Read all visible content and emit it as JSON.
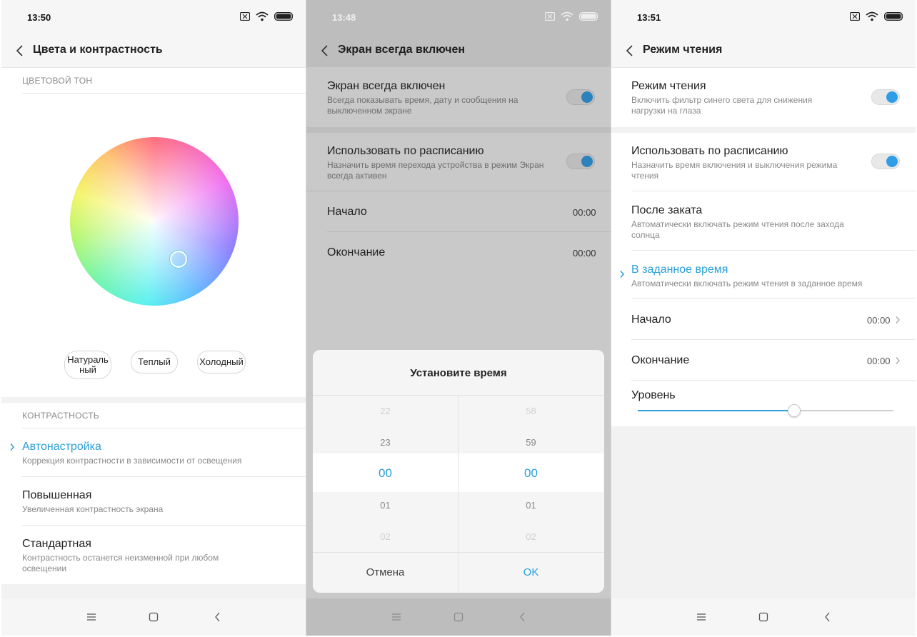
{
  "colors": {
    "accent": "#2a9fd8",
    "toggle_on": "#2f9ee6",
    "dim_overlay": "#c9c9c9"
  },
  "panel1": {
    "status": {
      "time": "13:50",
      "icons": [
        "sim-off-icon",
        "wifi-icon",
        "battery-icon"
      ]
    },
    "header": {
      "title": "Цвета и контрастность"
    },
    "color_tone": {
      "section_label": "ЦВЕТОВОЙ ТОН",
      "presets": [
        "Натураль ный",
        "Теплый",
        "Холодный"
      ]
    },
    "contrast": {
      "section_label": "КОНТРАСТНОСТЬ",
      "options": [
        {
          "title": "Автонастройка",
          "subtitle": "Коррекция контрастности в зависимости от освещения",
          "selected": true
        },
        {
          "title": "Повышенная",
          "subtitle": "Увеличенная контрастность экрана",
          "selected": false
        },
        {
          "title": "Стандартная",
          "subtitle": "Контрастность останется неизменной при любом освещении",
          "selected": false
        }
      ]
    }
  },
  "panel2": {
    "status": {
      "time": "13:48",
      "icons": [
        "sim-off-icon",
        "wifi-icon",
        "battery-icon"
      ]
    },
    "header": {
      "title": "Экран всегда включен"
    },
    "settings": [
      {
        "title": "Экран всегда включен",
        "subtitle": "Всегда показывать время, дату и сообщения на выключенном экране",
        "toggle": true
      },
      {
        "title": "Использовать по расписанию",
        "subtitle": "Назначить время перехода устройства в режим Экран всегда активен",
        "toggle": true
      },
      {
        "title": "Начало",
        "value": "00:00"
      },
      {
        "title": "Окончание",
        "value": "00:00"
      }
    ],
    "dialog": {
      "title": "Установите время",
      "hours": [
        "22",
        "23",
        "00",
        "01",
        "02"
      ],
      "minutes": [
        "58",
        "59",
        "00",
        "01",
        "02"
      ],
      "cancel_label": "Отмена",
      "ok_label": "OK"
    }
  },
  "panel3": {
    "status": {
      "time": "13:51",
      "icons": [
        "sim-off-icon",
        "wifi-icon",
        "battery-icon"
      ]
    },
    "header": {
      "title": "Режим чтения"
    },
    "settings": [
      {
        "title": "Режим чтения",
        "subtitle": "Включить фильтр синего света для снижения нагрузки на глаза",
        "toggle": true
      },
      {
        "title": "Использовать по расписанию",
        "subtitle": "Назначить время включения и выключения режима чтения",
        "toggle": true
      },
      {
        "title": "После заката",
        "subtitle": "Автоматически включать режим чтения после захода солнца"
      },
      {
        "title": "В заданное время",
        "subtitle": "Автоматически включать режим чтения в заданное время",
        "selected": true
      },
      {
        "title": "Начало",
        "value": "00:00"
      },
      {
        "title": "Окончание",
        "value": "00:00"
      },
      {
        "title": "Уровень",
        "level": 0.61
      }
    ]
  }
}
